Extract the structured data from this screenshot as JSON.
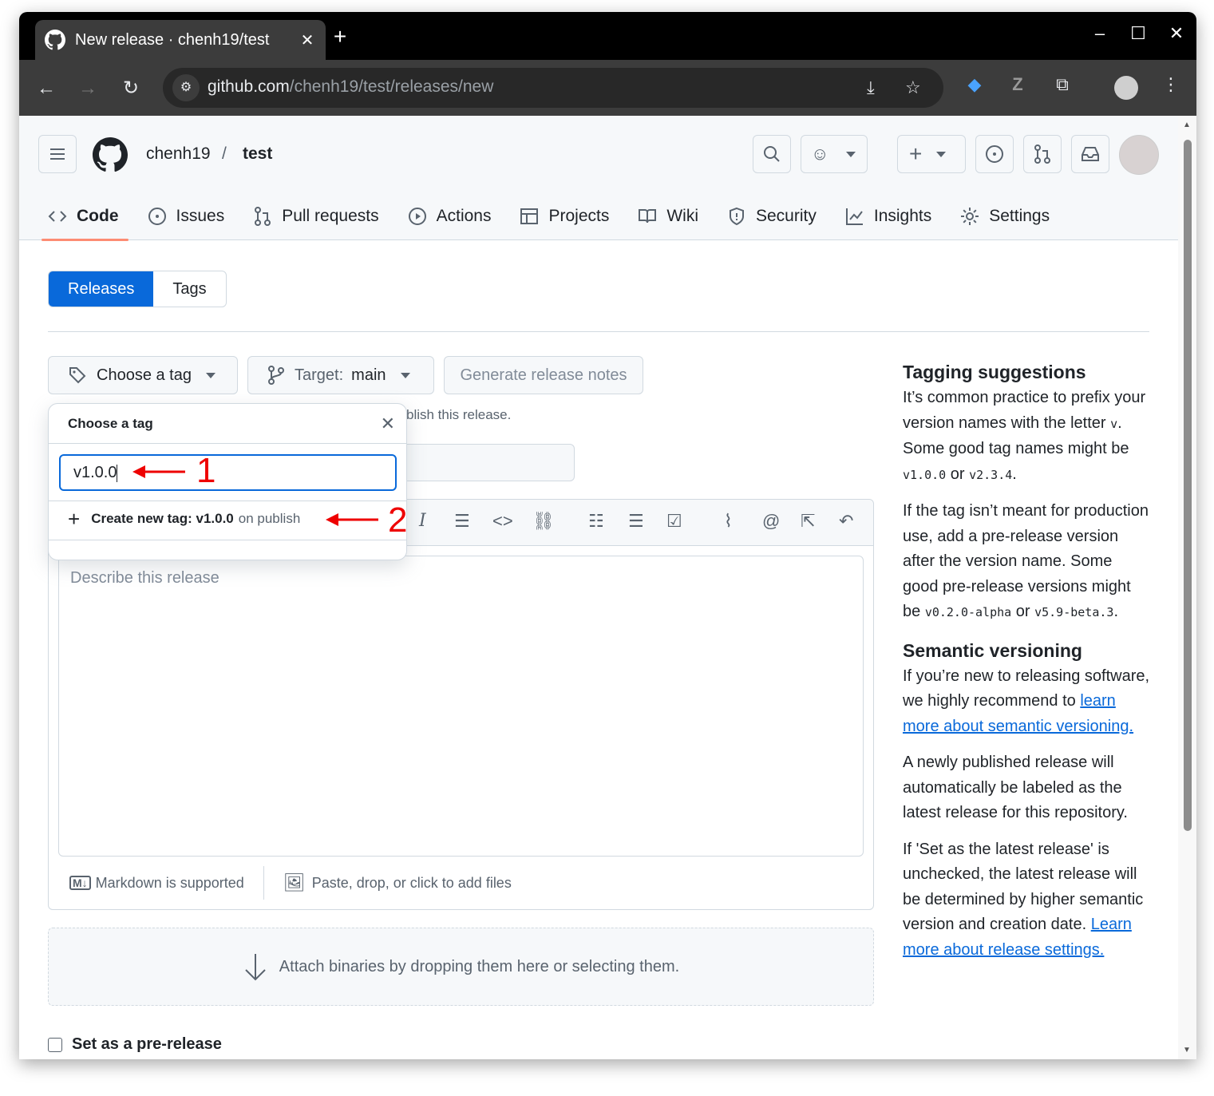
{
  "browser": {
    "tab_title": "New release · chenh19/test",
    "close": "✕",
    "new_tab": "+",
    "url_domain": "github.com",
    "url_path": "/chenh19/test/releases/new"
  },
  "repo": {
    "owner": "chenh19",
    "sep": "/",
    "name": "test"
  },
  "nav": [
    "Code",
    "Issues",
    "Pull requests",
    "Actions",
    "Projects",
    "Wiki",
    "Security",
    "Insights",
    "Settings"
  ],
  "tabs": {
    "releases": "Releases",
    "tags": "Tags"
  },
  "buttons": {
    "choose_tag": "Choose a tag",
    "target_label": "Target:",
    "target_value": "main",
    "generate": "Generate release notes"
  },
  "behind_text": "blish this release.",
  "dropdown": {
    "title": "Choose a tag",
    "input_value": "v1.0.0",
    "create_prefix": "Create new tag: v1.0.0",
    "create_suffix": "on publish"
  },
  "editor": {
    "placeholder": "Describe this release",
    "markdown": "Markdown is supported",
    "files": "Paste, drop, or click to add files"
  },
  "attach": "Attach binaries by dropping them here or selecting them.",
  "prerelease": "Set as a pre-release",
  "annotations": [
    "1",
    "2"
  ],
  "sidebar": {
    "h1": "Tagging suggestions",
    "p1a": "It’s common practice to prefix your version names with the letter ",
    "p1_code1": "v",
    "p1b": ". Some good tag names might be ",
    "p1_code2": "v1.0.0",
    "p1c": " or ",
    "p1_code3": "v2.3.4",
    "p1d": ".",
    "p2a": "If the tag isn’t meant for production use, add a pre-release version after the version name. Some good pre-release versions might be ",
    "p2_code1": "v0.2.0-alpha",
    "p2b": " or ",
    "p2_code2": "v5.9-beta.3",
    "p2c": ".",
    "h2": "Semantic versioning",
    "p3a": "If you’re new to releasing software, we highly recommend to ",
    "p3_link": "learn more about semantic versioning.",
    "p4": "A newly published release will automatically be labeled as the latest release for this repository.",
    "p5a": "If 'Set as the latest release' is unchecked, the latest release will be determined by higher semantic version and creation date. ",
    "p5_link": "Learn more about release settings."
  }
}
